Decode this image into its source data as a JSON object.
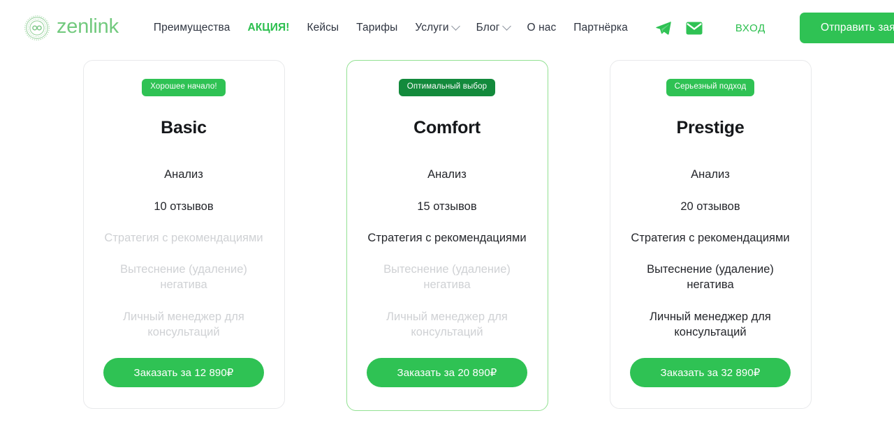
{
  "brand": {
    "name": "zenlink",
    "logo_icon": "zenlink-infinity-badge-icon",
    "color": "#71c97d"
  },
  "header": {
    "nav": [
      {
        "label": "Преимущества",
        "accent": false,
        "dropdown": false
      },
      {
        "label": "АКЦИЯ!",
        "accent": true,
        "dropdown": false
      },
      {
        "label": "Кейсы",
        "accent": false,
        "dropdown": false
      },
      {
        "label": "Тарифы",
        "accent": false,
        "dropdown": false
      },
      {
        "label": "Услуги",
        "accent": false,
        "dropdown": true
      },
      {
        "label": "Блог",
        "accent": false,
        "dropdown": true
      },
      {
        "label": "О нас",
        "accent": false,
        "dropdown": false
      },
      {
        "label": "Партнёрка",
        "accent": false,
        "dropdown": false
      }
    ],
    "social": [
      {
        "icon": "telegram-icon",
        "color": "#2fc254"
      },
      {
        "icon": "email-icon",
        "color": "#2fc254"
      }
    ],
    "login_label": "ВХОД",
    "cta_label": "Отправить заявку",
    "accent_color": "#2fc254"
  },
  "pricing": {
    "cards": [
      {
        "badge": "Хорошее начало!",
        "badge_style": "light",
        "name": "Basic",
        "featured": false,
        "features": [
          {
            "text": "Анализ",
            "included": true
          },
          {
            "text": "10 отзывов",
            "included": true
          },
          {
            "text": "Стратегия с рекомендациями",
            "included": false
          },
          {
            "text": "Вытеснение (удаление) негатива",
            "included": false
          },
          {
            "text": "Личный менеджер для консультаций",
            "included": false
          }
        ],
        "button_label": "Заказать за 12 890₽",
        "price": "12 890₽"
      },
      {
        "badge": "Оптимальный выбор",
        "badge_style": "dark",
        "name": "Comfort",
        "featured": true,
        "features": [
          {
            "text": "Анализ",
            "included": true
          },
          {
            "text": "15 отзывов",
            "included": true
          },
          {
            "text": "Стратегия с рекомендациями",
            "included": true
          },
          {
            "text": "Вытеснение (удаление) негатива",
            "included": false
          },
          {
            "text": "Личный менеджер для консультаций",
            "included": false
          }
        ],
        "button_label": "Заказать за 20 890₽",
        "price": "20 890₽"
      },
      {
        "badge": "Серьезный подход",
        "badge_style": "light",
        "name": "Prestige",
        "featured": false,
        "features": [
          {
            "text": "Анализ",
            "included": true
          },
          {
            "text": "20 отзывов",
            "included": true
          },
          {
            "text": "Стратегия с рекомендациями",
            "included": true
          },
          {
            "text": "Вытеснение (удаление) негатива",
            "included": true
          },
          {
            "text": "Личный менеджер для консультаций",
            "included": true
          }
        ],
        "button_label": "Заказать за 32 890₽",
        "price": "32 890₽"
      }
    ]
  }
}
